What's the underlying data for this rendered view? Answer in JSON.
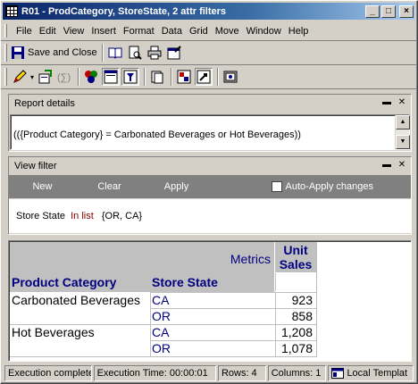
{
  "window": {
    "title": "R01 - ProdCategory, StoreState, 2 attr filters",
    "minimize": "_",
    "maximize": "□",
    "close": "×"
  },
  "menu": [
    "File",
    "Edit",
    "View",
    "Insert",
    "Format",
    "Data",
    "Grid",
    "Move",
    "Window",
    "Help"
  ],
  "toolbar": {
    "save_and_close": "Save and Close"
  },
  "report_details": {
    "title": "Report details",
    "text": "(({Product Category} = Carbonated Beverages or Hot Beverages))"
  },
  "view_filter": {
    "title": "View filter",
    "new": "New",
    "clear": "Clear",
    "apply": "Apply",
    "auto_apply": "Auto-Apply changes",
    "condition": {
      "attribute": "Store State",
      "operator": "In list",
      "values": "{OR, CA}"
    }
  },
  "grid": {
    "metrics_label": "Metrics",
    "metric_header_line1": "Unit",
    "metric_header_line2": "Sales",
    "col1_header": "Product Category",
    "col2_header": "Store State",
    "rows": [
      {
        "category": "Carbonated Beverages",
        "state": "CA",
        "value": "923"
      },
      {
        "category": "",
        "state": "OR",
        "value": "858"
      },
      {
        "category": "Hot Beverages",
        "state": "CA",
        "value": "1,208"
      },
      {
        "category": "",
        "state": "OR",
        "value": "1,078"
      }
    ]
  },
  "status": {
    "state": "Execution complete",
    "time": "Execution Time: 00:00:01",
    "rows": "Rows: 4",
    "columns": "Columns: 1",
    "template": "Local Templat"
  },
  "colors": {
    "header_bg": "#c0c0c0",
    "header_text": "#000080",
    "filter_operator": "#800000"
  }
}
